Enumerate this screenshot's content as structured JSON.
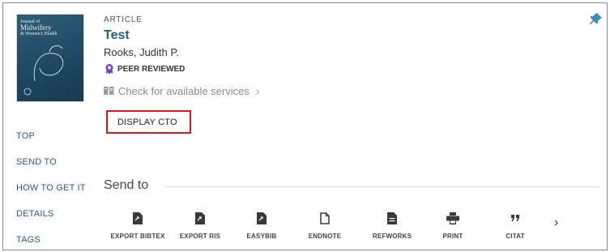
{
  "record": {
    "type": "ARTICLE",
    "title": "Test",
    "author": "Rooks, Judith P.",
    "peer_reviewed": "PEER REVIEWED",
    "services_link": "Check for available services",
    "cover": {
      "line1": "Journal of",
      "line2": "Midwifery",
      "line3": "& Women's Health"
    }
  },
  "actions_top": {
    "display_cto": "DISPLAY CTO"
  },
  "sidebar": {
    "items": [
      {
        "label": "TOP"
      },
      {
        "label": "SEND TO"
      },
      {
        "label": "HOW TO GET IT"
      },
      {
        "label": "DETAILS"
      },
      {
        "label": "TAGS"
      }
    ]
  },
  "send_to": {
    "heading": "Send to",
    "actions": [
      {
        "label": "EXPORT BIBTEX",
        "icon": "export-bibtex-icon"
      },
      {
        "label": "EXPORT RIS",
        "icon": "export-ris-icon"
      },
      {
        "label": "EASYBIB",
        "icon": "easybib-icon"
      },
      {
        "label": "ENDNOTE",
        "icon": "endnote-icon"
      },
      {
        "label": "REFWORKS",
        "icon": "refworks-icon"
      },
      {
        "label": "PRINT",
        "icon": "print-icon"
      },
      {
        "label": "CITAT",
        "icon": "citation-icon"
      }
    ]
  },
  "colors": {
    "link": "#1f5f88",
    "highlight_border": "#e1141c",
    "pin": "#3a8fb7",
    "badge": "#7b3fc4"
  }
}
